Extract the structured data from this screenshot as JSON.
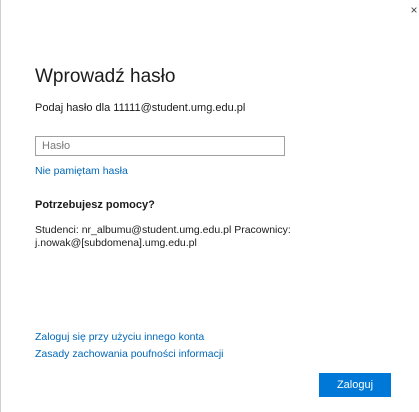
{
  "dialog": {
    "close_glyph": "×",
    "title": "Wprowadź hasło",
    "subtitle": "Podaj hasło dla 11111@student.umg.edu.pl",
    "password": {
      "value": "",
      "placeholder": "Hasło"
    },
    "forgot_link": "Nie pamiętam hasła",
    "help_heading": "Potrzebujesz pomocy?",
    "help_text": "Studenci: nr_albumu@student.umg.edu.pl Pracownicy: j.nowak@[subdomena].umg.edu.pl",
    "other_account_link": "Zaloguj się przy użyciu innego konta",
    "privacy_link": "Zasady zachowania poufności informacji",
    "signin_button": "Zaloguj"
  },
  "colors": {
    "accent": "#0078d7",
    "link": "#0067b8",
    "text": "#1b1b1b"
  }
}
